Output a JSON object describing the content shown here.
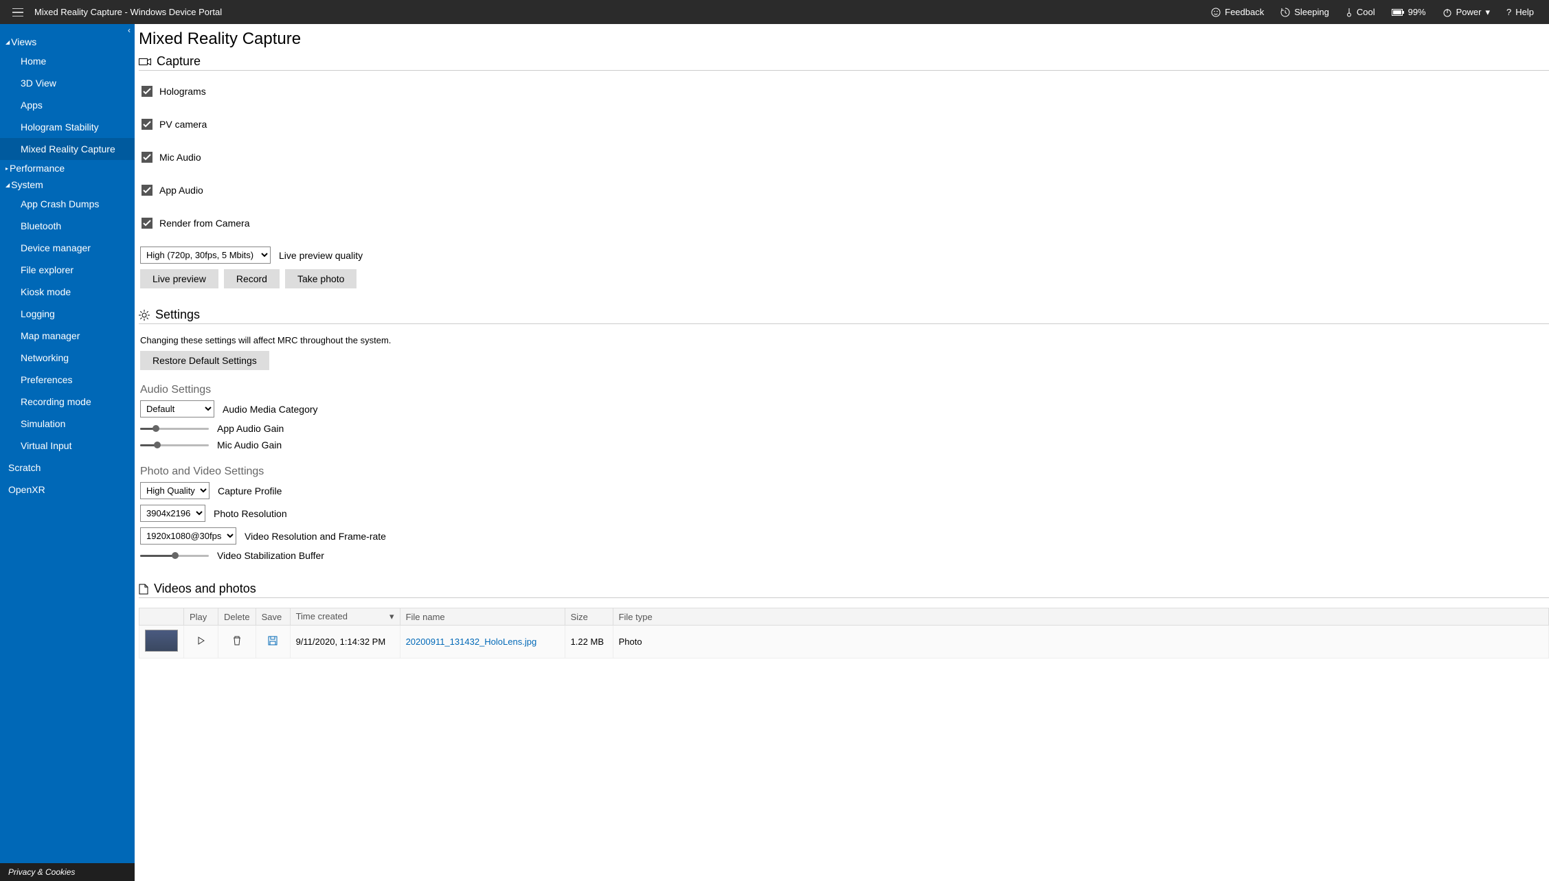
{
  "header": {
    "title": "Mixed Reality Capture - Windows Device Portal",
    "items": {
      "feedback": "Feedback",
      "sleeping": "Sleeping",
      "cool": "Cool",
      "battery": "99%",
      "power": "Power",
      "help": "Help"
    }
  },
  "sidebar": {
    "groups": [
      {
        "label": "Views",
        "expanded": true,
        "items": [
          "Home",
          "3D View",
          "Apps",
          "Hologram Stability",
          "Mixed Reality Capture"
        ],
        "active": "Mixed Reality Capture"
      },
      {
        "label": "Performance",
        "expanded": false,
        "items": []
      },
      {
        "label": "System",
        "expanded": true,
        "items": [
          "App Crash Dumps",
          "Bluetooth",
          "Device manager",
          "File explorer",
          "Kiosk mode",
          "Logging",
          "Map manager",
          "Networking",
          "Preferences",
          "Recording mode",
          "Simulation",
          "Virtual Input"
        ]
      }
    ],
    "roots": [
      "Scratch",
      "OpenXR"
    ],
    "footer": "Privacy & Cookies"
  },
  "page": {
    "title": "Mixed Reality Capture",
    "capture": {
      "title": "Capture",
      "checks": [
        "Holograms",
        "PV camera",
        "Mic Audio",
        "App Audio",
        "Render from Camera"
      ],
      "quality_select": "High (720p, 30fps, 5 Mbits)",
      "quality_label": "Live preview quality",
      "buttons": [
        "Live preview",
        "Record",
        "Take photo"
      ]
    },
    "settings": {
      "title": "Settings",
      "note": "Changing these settings will affect MRC throughout the system.",
      "restore": "Restore Default Settings",
      "audio_title": "Audio Settings",
      "audio_media_select": "Default",
      "audio_media_label": "Audio Media Category",
      "app_gain_label": "App Audio Gain",
      "mic_gain_label": "Mic Audio Gain",
      "pv_title": "Photo and Video Settings",
      "profile_select": "High Quality",
      "profile_label": "Capture Profile",
      "photo_res_select": "3904x2196",
      "photo_res_label": "Photo Resolution",
      "video_res_select": "1920x1080@30fps",
      "video_res_label": "Video Resolution and Frame-rate",
      "stab_label": "Video Stabilization Buffer"
    },
    "media": {
      "title": "Videos and photos",
      "columns": [
        "",
        "Play",
        "Delete",
        "Save",
        "Time created",
        "File name",
        "Size",
        "File type"
      ],
      "rows": [
        {
          "time": "9/11/2020, 1:14:32 PM",
          "file": "20200911_131432_HoloLens.jpg",
          "size": "1.22 MB",
          "type": "Photo"
        }
      ]
    }
  }
}
